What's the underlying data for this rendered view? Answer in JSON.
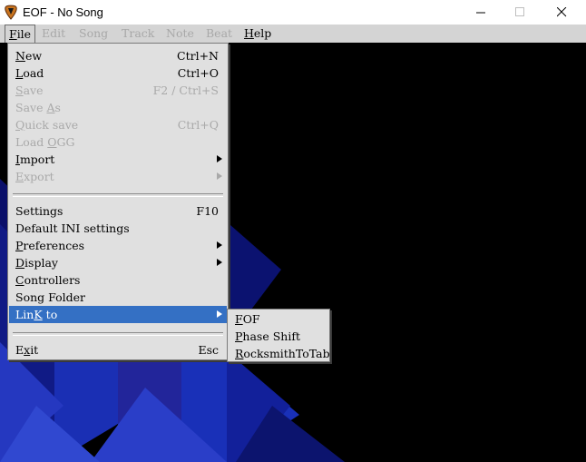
{
  "window": {
    "title": "EOF - No Song",
    "controls": {
      "minimize_icon": "minimize-icon",
      "maximize_icon": "maximize-icon",
      "close_icon": "close-icon"
    }
  },
  "menubar": [
    {
      "label": "File",
      "mnemonic": "F",
      "rest": "ile",
      "state": "active"
    },
    {
      "label": "Edit",
      "state": "disabled"
    },
    {
      "label": "Song",
      "state": "disabled"
    },
    {
      "label": "Track",
      "state": "disabled"
    },
    {
      "label": "Note",
      "state": "disabled"
    },
    {
      "label": "Beat",
      "state": "disabled"
    },
    {
      "label": "Help",
      "mnemonic": "H",
      "rest": "elp",
      "state": "enabled"
    }
  ],
  "file_menu": {
    "items": [
      {
        "label": "New",
        "pre": "",
        "mnemonic": "N",
        "post": "ew",
        "shortcut": "Ctrl+N",
        "enabled": true
      },
      {
        "label": "Load",
        "pre": "",
        "mnemonic": "L",
        "post": "oad",
        "shortcut": "Ctrl+O",
        "enabled": true
      },
      {
        "label": "Save",
        "pre": "",
        "mnemonic": "S",
        "post": "ave",
        "shortcut": "F2 / Ctrl+S",
        "enabled": false
      },
      {
        "label": "Save As",
        "pre": "Save ",
        "mnemonic": "A",
        "post": "s",
        "shortcut": "",
        "enabled": false
      },
      {
        "label": "Quick save",
        "pre": "",
        "mnemonic": "Q",
        "post": "uick save",
        "shortcut": "Ctrl+Q",
        "enabled": false
      },
      {
        "label": "Load OGG",
        "pre": "Load ",
        "mnemonic": "O",
        "post": "GG",
        "shortcut": "",
        "enabled": false
      },
      {
        "label": "Import",
        "pre": "",
        "mnemonic": "I",
        "post": "mport",
        "shortcut": "",
        "enabled": true,
        "submenu": true
      },
      {
        "label": "Export",
        "pre": "",
        "mnemonic": "E",
        "post": "xport",
        "shortcut": "",
        "enabled": false,
        "submenu": true
      },
      {
        "label": "Settings",
        "pre": "",
        "mnemonic": "",
        "post": "Settings",
        "shortcut": "F10",
        "enabled": true
      },
      {
        "label": "Default INI settings",
        "pre": "",
        "mnemonic": "",
        "post": "Default INI settings",
        "shortcut": "",
        "enabled": true
      },
      {
        "label": "Preferences",
        "pre": "",
        "mnemonic": "P",
        "post": "references",
        "shortcut": "",
        "enabled": true,
        "submenu": true
      },
      {
        "label": "Display",
        "pre": "",
        "mnemonic": "D",
        "post": "isplay",
        "shortcut": "",
        "enabled": true,
        "submenu": true
      },
      {
        "label": "Controllers",
        "pre": "",
        "mnemonic": "C",
        "post": "ontrollers",
        "shortcut": "",
        "enabled": true
      },
      {
        "label": "Song Folder",
        "pre": "",
        "mnemonic": "",
        "post": "Song Folder",
        "shortcut": "",
        "enabled": true
      },
      {
        "label": "LinK to",
        "pre": "Lin",
        "mnemonic": "K",
        "post": " to",
        "shortcut": "",
        "enabled": true,
        "submenu": true,
        "selected": true
      },
      {
        "label": "Exit",
        "pre": "E",
        "mnemonic": "x",
        "post": "it",
        "shortcut": "Esc",
        "enabled": true
      }
    ]
  },
  "link_submenu": {
    "items": [
      {
        "label": "FOF",
        "pre": "",
        "mnemonic": "F",
        "post": "OF"
      },
      {
        "label": "Phase Shift",
        "pre": "",
        "mnemonic": "P",
        "post": "hase Shift"
      },
      {
        "label": "RocksmithToTab",
        "pre": "",
        "mnemonic": "R",
        "post": "ocksmithToTab"
      }
    ]
  },
  "colors": {
    "accent_selection": "#3470c4",
    "background": "#000000",
    "menu_bg": "#e0e0e0",
    "disabled_text": "#a9a9a9"
  }
}
